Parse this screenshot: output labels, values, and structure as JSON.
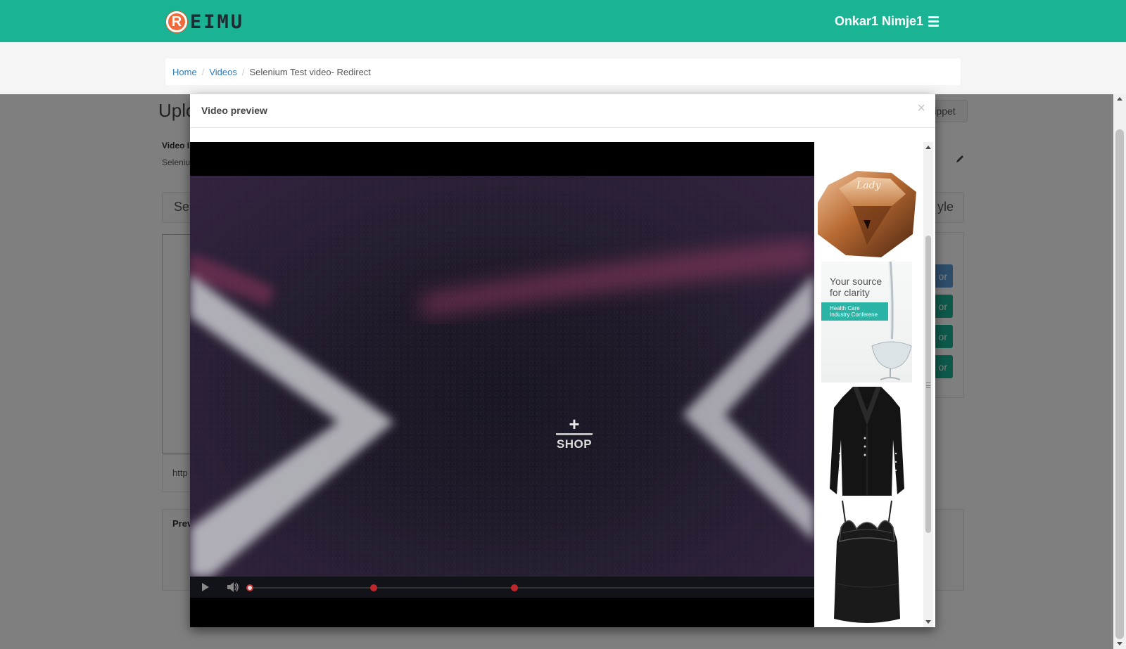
{
  "navbar": {
    "logo_letter": "R",
    "logo_text": "EIMU",
    "user_name": "Onkar1 Nimje1",
    "menu_icon": "hamburger-icon",
    "bg_color": "#1ab394"
  },
  "breadcrumb": {
    "items": [
      "Home",
      "Videos"
    ],
    "active": "Selenium Test video- Redirect"
  },
  "background_page": {
    "title": "Uplo",
    "snippet_button": "ippet",
    "video_label": "Video I",
    "video_value": "Seleniu",
    "select_text": "Sel",
    "style_text": "yle",
    "url_text": "http",
    "preview_label": "Prev",
    "button_suffix": "or",
    "button_colors": [
      "#5b9bd5",
      "#1ab394",
      "#1ab394",
      "#1ab394"
    ]
  },
  "modal": {
    "title": "Video preview",
    "close_label": "×",
    "video": {
      "shop_plus": "+",
      "shop_label": "SHOP",
      "progress": 0.0,
      "marker_positions": [
        0.22,
        0.47
      ],
      "marker_color": "#c0272d"
    },
    "products": [
      {
        "name": "perfume",
        "icon": "perfume-bottle-image"
      },
      {
        "name": "ad",
        "icon": "ad-banner-image"
      },
      {
        "name": "blazer",
        "icon": "black-blazer-image"
      },
      {
        "name": "camisole",
        "icon": "black-lace-top-image"
      }
    ],
    "ad": {
      "title_line1": "Your source",
      "title_line2": "for clarity",
      "banner_line1": "Health Care",
      "banner_line2": "Industry Conferene"
    }
  }
}
